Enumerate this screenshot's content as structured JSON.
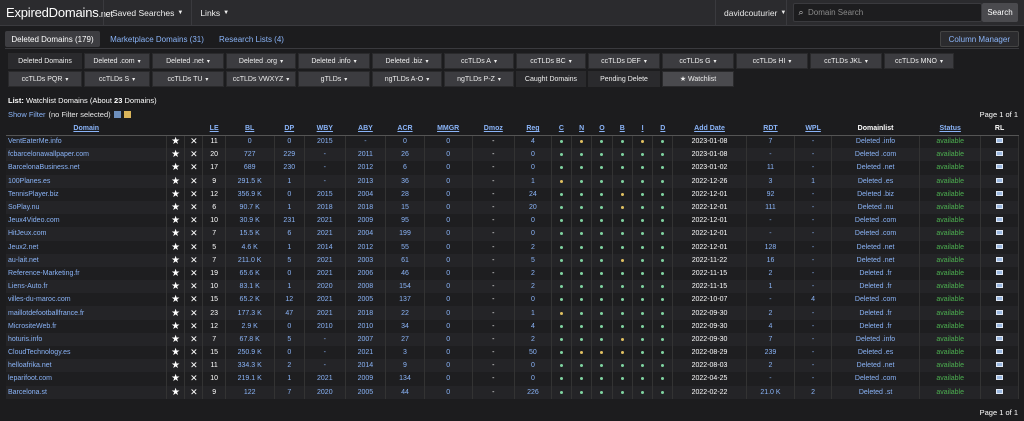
{
  "brand": {
    "name": "ExpiredDomains",
    "tld": ".net"
  },
  "nav": {
    "saved": "Saved Searches",
    "links": "Links",
    "user": "davidcouturier"
  },
  "search": {
    "placeholder": "Domain Search",
    "button": "Search"
  },
  "tabs": [
    "Deleted Domains (179)",
    "Marketplace Domains (31)",
    "Research Lists (4)"
  ],
  "column_manager": "Column Manager",
  "filters_row1": [
    "Deleted Domains",
    "Deleted .com",
    "Deleted .net",
    "Deleted .org",
    "Deleted .info",
    "Deleted .biz",
    "ccTLDs A",
    "ccTLDs BC",
    "ccTLDs DEF",
    "ccTLDs G",
    "ccTLDs HI",
    "ccTLDs JKL",
    "ccTLDs MNO"
  ],
  "filters_row2": [
    "ccTLDs PQR",
    "ccTLDs S",
    "ccTLDs TU",
    "ccTLDs VWXYZ",
    "gTLDs",
    "ngTLDs A-O",
    "ngTLDs P-Z",
    "Caught Domains",
    "Pending Delete",
    "★ Watchlist"
  ],
  "list": {
    "label": "List:",
    "title": "Watchlist Domains (About",
    "count": "23",
    "suffix": "Domains)"
  },
  "show_filter": "Show Filter",
  "no_filter": "(no Filter selected)",
  "page_info": "Page 1 of 1",
  "columns": [
    "Domain",
    "",
    "",
    "LE",
    "BL",
    "DP",
    "WBY",
    "ABY",
    "ACR",
    "MMGR",
    "Dmoz",
    "Reg",
    "C",
    "N",
    "O",
    "B",
    "I",
    "D",
    "Add Date",
    "RDT",
    "WPL",
    "Domainlist",
    "Status",
    "RL"
  ],
  "colors": {
    "accent": "#8ab4f8",
    "available": "#4caf50",
    "dot_green": "#7fd3a0",
    "dot_yellow": "#e0c060"
  },
  "rows": [
    {
      "domain": "VentEaterMe.info",
      "le": "11",
      "bl": "0",
      "dp": "0",
      "wby": "2015",
      "aby": "-",
      "acr": "0",
      "mmgr": "0",
      "dmoz": "-",
      "reg": "4",
      "dots": "gyggyg",
      "date": "2023-01-08",
      "rdt": "7",
      "wpl": "-",
      "list": "Deleted .info",
      "status": "available"
    },
    {
      "domain": "fcbarcelonawallpaper.com",
      "le": "20",
      "bl": "727",
      "dp": "229",
      "wby": "-",
      "aby": "2011",
      "acr": "26",
      "mmgr": "0",
      "dmoz": "-",
      "reg": "0",
      "dots": "gggggg",
      "date": "2023-01-08",
      "rdt": "-",
      "wpl": "-",
      "list": "Deleted .com",
      "status": "available"
    },
    {
      "domain": "BarcelonaBusiness.net",
      "le": "17",
      "bl": "689",
      "dp": "230",
      "wby": "-",
      "aby": "2012",
      "acr": "6",
      "mmgr": "0",
      "dmoz": "-",
      "reg": "0",
      "dots": "gggggg",
      "date": "2023-01-02",
      "rdt": "11",
      "wpl": "-",
      "list": "Deleted .net",
      "status": "available"
    },
    {
      "domain": "100Planes.es",
      "le": "9",
      "bl": "291.5 K",
      "dp": "1",
      "wby": "-",
      "aby": "2013",
      "acr": "36",
      "mmgr": "0",
      "dmoz": "-",
      "reg": "1",
      "dots": "yggggg",
      "date": "2022-12-26",
      "rdt": "3",
      "wpl": "1",
      "list": "Deleted .es",
      "status": "available"
    },
    {
      "domain": "TennisPlayer.biz",
      "le": "12",
      "bl": "356.9 K",
      "dp": "0",
      "wby": "2015",
      "aby": "2004",
      "acr": "28",
      "mmgr": "0",
      "dmoz": "-",
      "reg": "24",
      "dots": "gggygg",
      "date": "2022-12-01",
      "rdt": "92",
      "wpl": "-",
      "list": "Deleted .biz",
      "status": "available"
    },
    {
      "domain": "SoPlay.nu",
      "le": "6",
      "bl": "90.7 K",
      "dp": "1",
      "wby": "2018",
      "aby": "2018",
      "acr": "15",
      "mmgr": "0",
      "dmoz": "-",
      "reg": "20",
      "dots": "gggygg",
      "date": "2022-12-01",
      "rdt": "111",
      "wpl": "-",
      "list": "Deleted .nu",
      "status": "available"
    },
    {
      "domain": "Jeux4Video.com",
      "le": "10",
      "bl": "30.9 K",
      "dp": "231",
      "wby": "2021",
      "aby": "2009",
      "acr": "95",
      "mmgr": "0",
      "dmoz": "-",
      "reg": "0",
      "dots": "gggggg",
      "date": "2022-12-01",
      "rdt": "-",
      "wpl": "-",
      "list": "Deleted .com",
      "status": "available"
    },
    {
      "domain": "HitJeux.com",
      "le": "7",
      "bl": "15.5 K",
      "dp": "6",
      "wby": "2021",
      "aby": "2004",
      "acr": "199",
      "mmgr": "0",
      "dmoz": "-",
      "reg": "0",
      "dots": "gggggg",
      "date": "2022-12-01",
      "rdt": "-",
      "wpl": "-",
      "list": "Deleted .com",
      "status": "available"
    },
    {
      "domain": "Jeux2.net",
      "le": "5",
      "bl": "4.6 K",
      "dp": "1",
      "wby": "2014",
      "aby": "2012",
      "acr": "55",
      "mmgr": "0",
      "dmoz": "-",
      "reg": "2",
      "dots": "gggggg",
      "date": "2022-12-01",
      "rdt": "128",
      "wpl": "-",
      "list": "Deleted .net",
      "status": "available"
    },
    {
      "domain": "au-lait.net",
      "le": "7",
      "bl": "211.0 K",
      "dp": "5",
      "wby": "2021",
      "aby": "2003",
      "acr": "61",
      "mmgr": "0",
      "dmoz": "-",
      "reg": "5",
      "dots": "gggygg",
      "date": "2022-11-22",
      "rdt": "16",
      "wpl": "-",
      "list": "Deleted .net",
      "status": "available"
    },
    {
      "domain": "Reference-Marketing.fr",
      "le": "19",
      "bl": "65.6 K",
      "dp": "0",
      "wby": "2021",
      "aby": "2006",
      "acr": "46",
      "mmgr": "0",
      "dmoz": "-",
      "reg": "2",
      "dots": "gggggg",
      "date": "2022-11-15",
      "rdt": "2",
      "wpl": "-",
      "list": "Deleted .fr",
      "status": "available"
    },
    {
      "domain": "Liens-Auto.fr",
      "le": "10",
      "bl": "83.1 K",
      "dp": "1",
      "wby": "2020",
      "aby": "2008",
      "acr": "154",
      "mmgr": "0",
      "dmoz": "-",
      "reg": "2",
      "dots": "gggggg",
      "date": "2022-11-15",
      "rdt": "1",
      "wpl": "-",
      "list": "Deleted .fr",
      "status": "available"
    },
    {
      "domain": "villes-du-maroc.com",
      "le": "15",
      "bl": "65.2 K",
      "dp": "12",
      "wby": "2021",
      "aby": "2005",
      "acr": "137",
      "mmgr": "0",
      "dmoz": "-",
      "reg": "0",
      "dots": "gggggg",
      "date": "2022-10-07",
      "rdt": "-",
      "wpl": "4",
      "list": "Deleted .com",
      "status": "available"
    },
    {
      "domain": "maillotdefootballfrance.fr",
      "le": "23",
      "bl": "177.3 K",
      "dp": "47",
      "wby": "2021",
      "aby": "2018",
      "acr": "22",
      "mmgr": "0",
      "dmoz": "-",
      "reg": "1",
      "dots": "yggggg",
      "date": "2022-09-30",
      "rdt": "2",
      "wpl": "-",
      "list": "Deleted .fr",
      "status": "available"
    },
    {
      "domain": "MicrositeWeb.fr",
      "le": "12",
      "bl": "2.9 K",
      "dp": "0",
      "wby": "2010",
      "aby": "2010",
      "acr": "34",
      "mmgr": "0",
      "dmoz": "-",
      "reg": "4",
      "dots": "gggggg",
      "date": "2022-09-30",
      "rdt": "4",
      "wpl": "-",
      "list": "Deleted .fr",
      "status": "available"
    },
    {
      "domain": "hoturis.info",
      "le": "7",
      "bl": "67.8 K",
      "dp": "5",
      "wby": "-",
      "aby": "2007",
      "acr": "27",
      "mmgr": "0",
      "dmoz": "-",
      "reg": "2",
      "dots": "gggygg",
      "date": "2022-09-30",
      "rdt": "7",
      "wpl": "-",
      "list": "Deleted .info",
      "status": "available"
    },
    {
      "domain": "CloudTechnology.es",
      "le": "15",
      "bl": "250.9 K",
      "dp": "0",
      "wby": "-",
      "aby": "2021",
      "acr": "3",
      "mmgr": "0",
      "dmoz": "-",
      "reg": "50",
      "dots": "gyyygg",
      "date": "2022-08-29",
      "rdt": "239",
      "wpl": "-",
      "list": "Deleted .es",
      "status": "available"
    },
    {
      "domain": "helloafrika.net",
      "le": "11",
      "bl": "334.3 K",
      "dp": "2",
      "wby": "-",
      "aby": "2014",
      "acr": "9",
      "mmgr": "0",
      "dmoz": "-",
      "reg": "0",
      "dots": "gggggg",
      "date": "2022-08-03",
      "rdt": "2",
      "wpl": "-",
      "list": "Deleted .net",
      "status": "available"
    },
    {
      "domain": "leparifoot.com",
      "le": "10",
      "bl": "219.1 K",
      "dp": "1",
      "wby": "2021",
      "aby": "2009",
      "acr": "134",
      "mmgr": "0",
      "dmoz": "-",
      "reg": "0",
      "dots": "gggggg",
      "date": "2022-04-25",
      "rdt": "-",
      "wpl": "-",
      "list": "Deleted .com",
      "status": "available"
    },
    {
      "domain": "Barcelona.st",
      "le": "9",
      "bl": "122",
      "dp": "7",
      "wby": "2020",
      "aby": "2005",
      "acr": "44",
      "mmgr": "0",
      "dmoz": "-",
      "reg": "226",
      "dots": "gggggg",
      "date": "2022-02-22",
      "rdt": "21.0 K",
      "wpl": "2",
      "list": "Deleted .st",
      "status": "available"
    }
  ]
}
